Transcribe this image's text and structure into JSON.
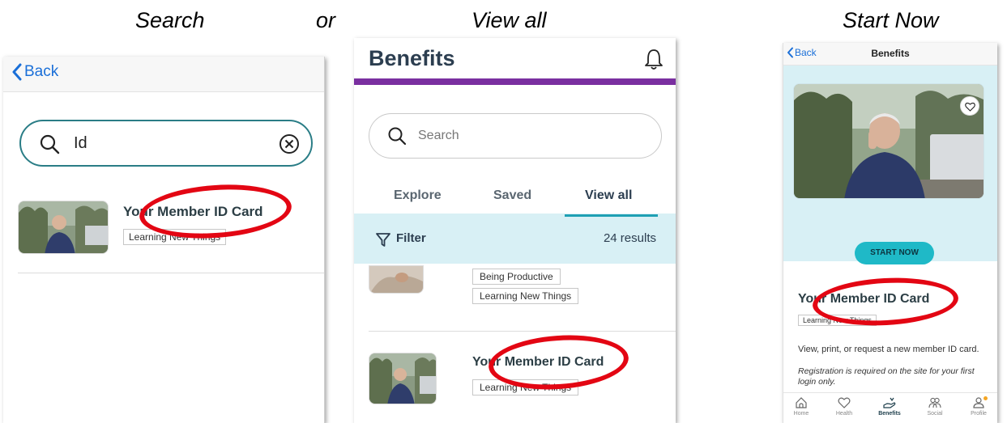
{
  "captions": {
    "search": "Search",
    "or": "or",
    "view_all": "View all",
    "start_now": "Start Now"
  },
  "colors": {
    "annotation": "#e30613",
    "accent_teal": "#1fa0b4",
    "brand_purple": "#7a2fa0",
    "link_blue": "#1a6fd8"
  },
  "search_screen": {
    "back_label": "Back",
    "search_value": "Id",
    "result": {
      "title": "Your Member ID Card",
      "tag": "Learning New Things"
    }
  },
  "benefits_screen": {
    "title": "Benefits",
    "search_placeholder": "Search",
    "tabs": [
      {
        "label": "Explore"
      },
      {
        "label": "Saved"
      },
      {
        "label": "View all",
        "active": true
      }
    ],
    "filter_label": "Filter",
    "results_count": "24 results",
    "item1_tags": [
      "Being Productive",
      "Learning New Things"
    ],
    "item2": {
      "title": "Your Member ID Card",
      "tag": "Learning New Things"
    }
  },
  "detail_screen": {
    "back_label": "Back",
    "title": "Benefits",
    "start_button": "START NOW",
    "card_title": "Your Member ID Card",
    "tag": "Learning New Things",
    "description": "View, print, or request a new member ID card.",
    "registration_note": "Registration is required on the site for your first login only.",
    "nav": [
      {
        "label": "Home",
        "icon": "home-icon"
      },
      {
        "label": "Health",
        "icon": "heart-icon"
      },
      {
        "label": "Benefits",
        "icon": "benefits-icon",
        "active": true
      },
      {
        "label": "Social",
        "icon": "people-icon"
      },
      {
        "label": "Profile",
        "icon": "person-icon"
      }
    ]
  }
}
